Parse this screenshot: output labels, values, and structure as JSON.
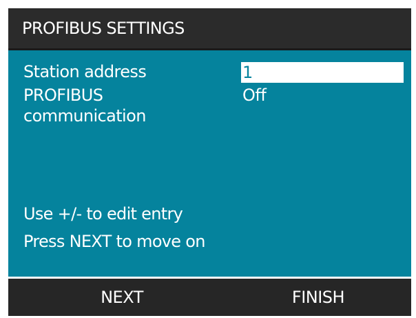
{
  "header": {
    "title": "PROFIBUS SETTINGS"
  },
  "fields": {
    "station_address": {
      "label": "Station address",
      "value": "1"
    },
    "profibus_communication": {
      "label": "PROFIBUS\ncommunication",
      "value": "Off"
    }
  },
  "help": {
    "line1": "Use +/- to edit entry",
    "line2": "Press NEXT to move on"
  },
  "softkeys": {
    "next_label": "NEXT",
    "finish_label": "FINISH"
  },
  "colors": {
    "screen_background": "#05839d",
    "header_background": "#2b2b2b",
    "softkey_background": "#262626",
    "text": "#ffffff"
  }
}
